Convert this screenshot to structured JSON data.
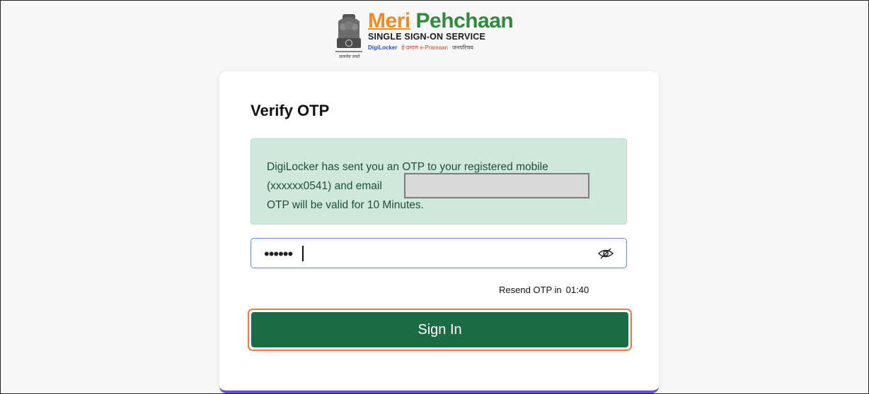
{
  "header": {
    "brand_part1": "Meri",
    "brand_part2": "Pehchaan",
    "subtitle": "SINGLE SIGN-ON SERVICE",
    "emblem_caption": "सत्यमेव जयते",
    "partners": [
      "DigiLocker",
      "ई-प्रमाण e-Pramaan",
      "जनपरिचय"
    ]
  },
  "card": {
    "title": "Verify OTP",
    "alert": {
      "line1": "DigiLocker has sent you an OTP to your registered mobile",
      "line2": "(xxxxxx0541) and email",
      "line3": "OTP will be valid for 10 Minutes."
    },
    "otp_field": {
      "masked_value": "••••••",
      "toggle_icon": "eye-slash-icon"
    },
    "resend": {
      "label": "Resend OTP in",
      "countdown": "01:40"
    },
    "signin_label": "Sign In"
  },
  "colors": {
    "alert_bg": "#cfe7dc",
    "button": "#1a6b46",
    "focus_ring": "#f07840",
    "card_bottom_accent": "#6a4de0"
  }
}
